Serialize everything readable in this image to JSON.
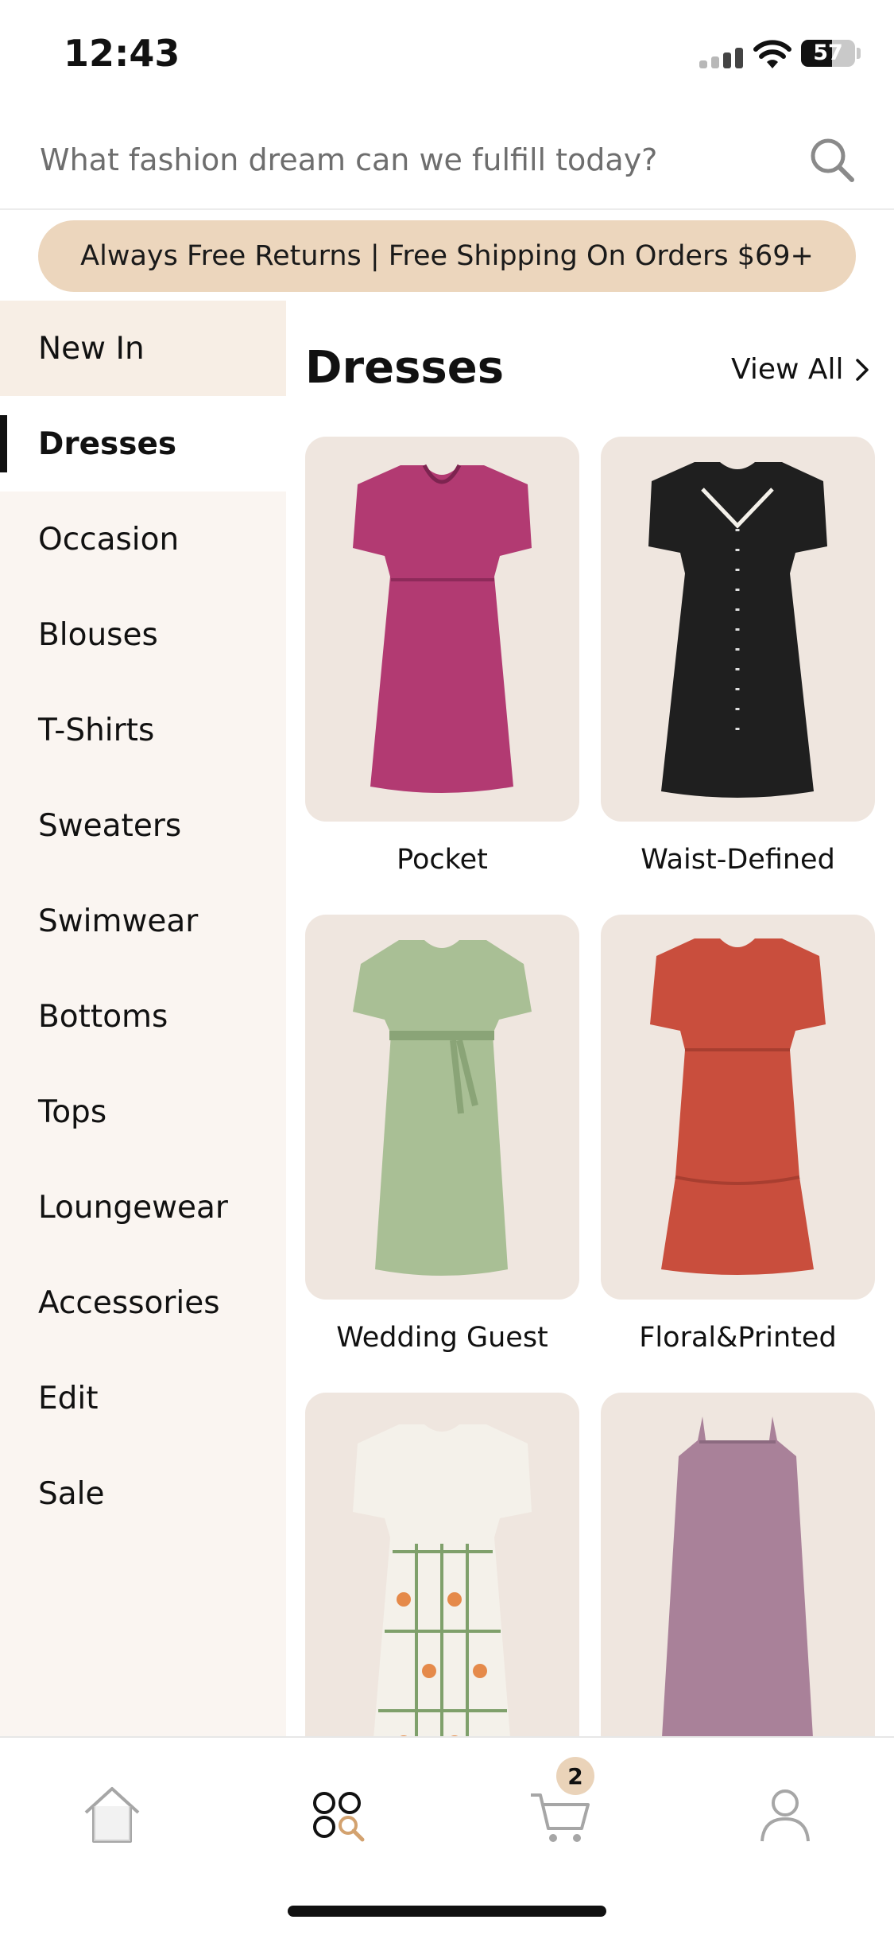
{
  "status_bar": {
    "time": "12:43",
    "battery": "57"
  },
  "search": {
    "placeholder": "What fashion dream can we fulfill today?"
  },
  "banner": {
    "text": "Always Free Returns | Free Shipping On Orders $69+"
  },
  "sidebar": {
    "items": [
      {
        "label": "New In"
      },
      {
        "label": "Dresses"
      },
      {
        "label": "Occasion"
      },
      {
        "label": "Blouses"
      },
      {
        "label": "T-Shirts"
      },
      {
        "label": "Sweaters"
      },
      {
        "label": "Swimwear"
      },
      {
        "label": "Bottoms"
      },
      {
        "label": "Tops"
      },
      {
        "label": "Loungewear"
      },
      {
        "label": "Accessories"
      },
      {
        "label": "Edit"
      },
      {
        "label": "Sale"
      }
    ],
    "active_label": "Dresses"
  },
  "main": {
    "title": "Dresses",
    "view_all": "View All",
    "cards": [
      {
        "label": "Pocket",
        "color": "#b23a72"
      },
      {
        "label": "Waist-Defined",
        "color": "#1f1f1f"
      },
      {
        "label": "Wedding Guest",
        "color": "#a9bf95"
      },
      {
        "label": "Floral&Printed",
        "color": "#c94e3d"
      },
      {
        "label": "",
        "color": "#f4f1ea"
      },
      {
        "label": "",
        "color": "#a98199"
      }
    ]
  },
  "tabbar": {
    "cart_badge": "2"
  },
  "colors": {
    "banner": "#ecd6bd",
    "sidebar_bg": "#faf5f1",
    "card_bg": "#efe6df"
  }
}
